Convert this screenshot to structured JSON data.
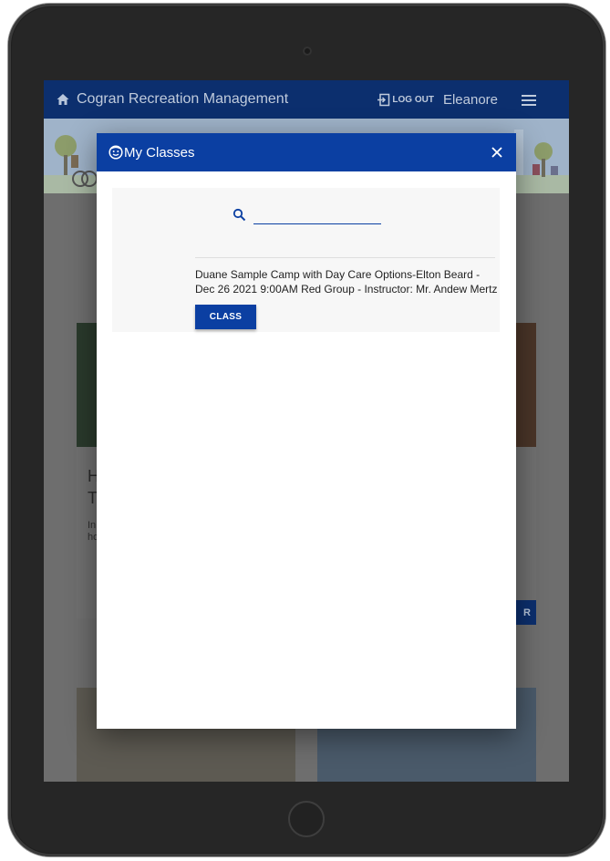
{
  "app": {
    "title": "Cogran Recreation Management",
    "logout_label": "LOG OUT",
    "username": "Eleanore"
  },
  "modal": {
    "title": "My Classes",
    "search": {
      "value": "",
      "placeholder": ""
    },
    "classes": [
      {
        "description": "Duane Sample Camp with Day Care Options-Elton Beard - Dec 26 2021 9:00AM Red Group - Instructor: Mr. Andew Mertz",
        "button_label": "CLASS"
      }
    ]
  },
  "background": {
    "card_heading_fragment": "H\nT",
    "card_body_fragment": "In\nho",
    "card_button_fragment": "R"
  },
  "colors": {
    "appbar": "#0c2f6e",
    "modal_header": "#0b3fa2",
    "button": "#0b3fa2",
    "panel": "#f7f7f7"
  },
  "icons": [
    "home-icon",
    "logout-icon",
    "menu-icon",
    "face-icon",
    "close-icon",
    "search-icon"
  ]
}
